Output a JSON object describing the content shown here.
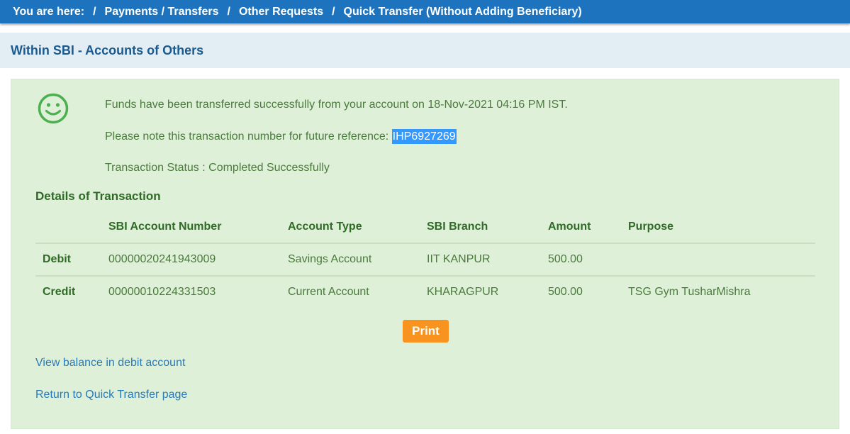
{
  "breadcrumb": {
    "prefix": "You are here:",
    "items": [
      "Payments / Transfers",
      "Other Requests",
      "Quick Transfer (Without Adding Beneficiary)"
    ],
    "separator": "/"
  },
  "section": {
    "title": "Within SBI - Accounts of Others"
  },
  "status_icon": "smiley-face-icon",
  "messages": {
    "line1": "Funds have been transferred successfully from your account on  18-Nov-2021 04:16 PM IST.",
    "line2_prefix": "Please note this transaction number for future reference: ",
    "transaction_number": "IHP6927269",
    "line3": "Transaction Status : Completed Successfully"
  },
  "details": {
    "title": "Details of Transaction",
    "columns": [
      "",
      "SBI Account Number",
      "Account Type",
      "SBI Branch",
      "Amount",
      "Purpose"
    ],
    "rows": [
      {
        "label": "Debit",
        "account": "00000020241943009",
        "type": "Savings Account",
        "branch": "IIT KANPUR",
        "amount": "500.00",
        "purpose": ""
      },
      {
        "label": "Credit",
        "account": "00000010224331503",
        "type": "Current Account",
        "branch": "KHARAGPUR",
        "amount": "500.00",
        "purpose": "TSG Gym TusharMishra"
      }
    ]
  },
  "print_label": "Print",
  "links": {
    "view_balance": "View balance in debit account",
    "return": "Return to Quick Transfer page"
  },
  "colors": {
    "topbar": "#1e73be",
    "panel": "#dff0d8",
    "accent_orange": "#f7931e",
    "success_green": "#4caf50",
    "link_blue": "#2a7ab8"
  }
}
